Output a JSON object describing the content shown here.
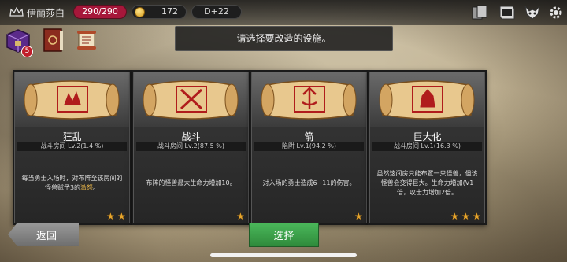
{
  "header": {
    "player_name": "伊丽莎白",
    "hp": "290/290",
    "gold": "172",
    "day": "D+22",
    "icons": [
      "crown-icon",
      "cards-icon",
      "book-icon",
      "demon-icon",
      "gear-icon"
    ]
  },
  "side_icons": {
    "inventory_badge": "5",
    "icons": [
      "chest-icon",
      "spellbook-icon",
      "scroll-icon"
    ]
  },
  "prompt": "请选择要改造的设施。",
  "cards": [
    {
      "title": "狂乱",
      "subtitle": "战斗房间 Lv.2(1.4 %)",
      "desc_pre": "每当勇士入场时，对布阵至该房间的怪兽赋予3的",
      "desc_hl": "激怒",
      "desc_post": "。",
      "stars": 2
    },
    {
      "title": "战斗",
      "subtitle": "战斗房间 Lv.2(87.5 %)",
      "desc_pre": "布阵的怪兽最大生命力增加10。",
      "desc_hl": "",
      "desc_post": "",
      "stars": 1
    },
    {
      "title": "箭",
      "subtitle": "陷阱 Lv.1(94.2 %)",
      "desc_pre": "对入场的勇士造成6~11的伤害。",
      "desc_hl": "",
      "desc_post": "",
      "stars": 1
    },
    {
      "title": "巨大化",
      "subtitle": "战斗房间 Lv.1(16.3 %)",
      "desc_pre": "虽然这间房只能布置一只怪兽，但该怪兽会变得巨大。生命力增加(V1倍，攻击力增加2倍。",
      "desc_hl": "",
      "desc_post": "",
      "stars": 3
    }
  ],
  "buttons": {
    "back": "返回",
    "select": "选择"
  },
  "colors": {
    "hp": "#a6173a",
    "select": "#3aa24a",
    "star": "#e6a52c",
    "scroll_mark": "#b01c1c"
  }
}
